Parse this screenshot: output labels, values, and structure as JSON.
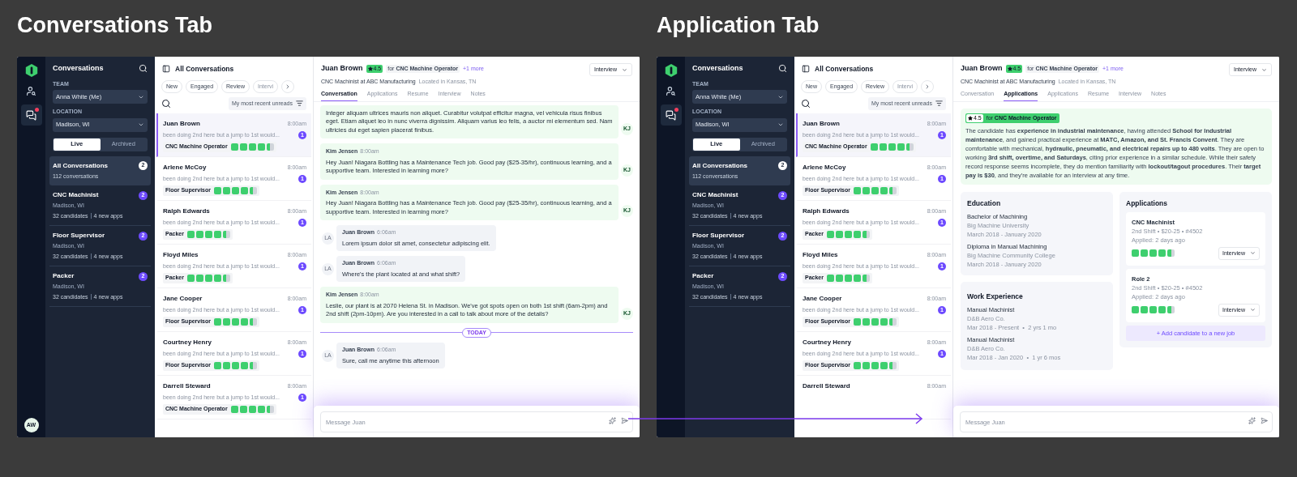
{
  "screens": [
    {
      "title": "Conversations Tab",
      "rail": {
        "avatar": "AW"
      },
      "sidebar": {
        "title": "Conversations",
        "team_label": "TEAM",
        "team": "Anna White (Me)",
        "location_label": "LOCATION",
        "location": "Madison, WI",
        "toggle": [
          {
            "label": "Live",
            "selected": true
          },
          {
            "label": "Archived",
            "selected": false
          }
        ],
        "groups": [
          {
            "name": "All Conversations",
            "sub": "112 conversations",
            "badge": "2",
            "selected": true
          },
          {
            "name": "CNC Machinist",
            "location": "Madison, WI",
            "candidates": "32 candidates",
            "apps": "4 new apps",
            "badge": "2",
            "selected": false
          },
          {
            "name": "Floor Supervisor",
            "location": "Madison, WI",
            "candidates": "32 candidates",
            "apps": "4 new apps",
            "badge": "2",
            "selected": false
          },
          {
            "name": "Packer",
            "location": "Madison, WI",
            "candidates": "32 candidates",
            "apps": "4 new apps",
            "badge": "2",
            "selected": false
          }
        ]
      },
      "list": {
        "title": "All Conversations",
        "filters": [
          "New",
          "Engaged",
          "Review",
          "Intervi"
        ],
        "sort": "My most recent unreads",
        "items": [
          {
            "name": "Juan Brown",
            "time": "8:00am",
            "preview": "been doing 2nd here but a jump to 1st would...",
            "unread": "1",
            "tag": "CNC Machine Operator",
            "stars": 4.5,
            "selected": true
          },
          {
            "name": "Arlene McCoy",
            "time": "8:00am",
            "preview": "been doing 2nd here but a jump to 1st would...",
            "unread": "1",
            "tag": "Floor Supervisor",
            "stars": 4.5,
            "selected": false
          },
          {
            "name": "Ralph Edwards",
            "time": "8:00am",
            "preview": "been doing 2nd here but a jump to 1st would...",
            "unread": "1",
            "tag": "Packer",
            "stars": 4.5,
            "selected": false
          },
          {
            "name": "Floyd Miles",
            "time": "8:00am",
            "preview": "been doing 2nd here but a jump to 1st would...",
            "unread": "1",
            "tag": "Packer",
            "stars": 4.5,
            "selected": false
          },
          {
            "name": "Jane Cooper",
            "time": "8:00am",
            "preview": "been doing 2nd here but a jump to 1st would...",
            "unread": "1",
            "tag": "Floor Supervisor",
            "stars": 4.5,
            "selected": false
          },
          {
            "name": "Courtney Henry",
            "time": "8:00am",
            "preview": "been doing 2nd here but a jump to 1st would...",
            "unread": "1",
            "tag": "Floor Supervisor",
            "stars": 4.5,
            "selected": false
          },
          {
            "name": "Darrell Steward",
            "time": "8:00am",
            "preview": "been doing 2nd here but a jump to 1st would...",
            "unread": "1",
            "tag": "CNC Machine Operator",
            "stars": 4.5,
            "selected": false
          }
        ]
      },
      "detail": {
        "kind": "conversation",
        "name": "Juan Brown",
        "rating": "4.5",
        "for": "for **CNC Machine Operator**",
        "more": "+1 more",
        "role": "CNC Machinist at ABC Manufacturing",
        "located": "Located in Kansas, TN",
        "status": "Interview",
        "tabs": [
          {
            "label": "Conversation",
            "selected": true
          },
          {
            "label": "Applications",
            "selected": false
          },
          {
            "label": "Resume",
            "selected": false
          },
          {
            "label": "Interview",
            "selected": false
          },
          {
            "label": "Notes",
            "selected": false
          }
        ],
        "messages": [
          {
            "kind": "recruiter",
            "text": "Integer aliquam ultrices mauris non aliquet. Curabitur volutpat efficitur magna, vel vehicula risus finibus eget. Etiam aliquet leo in nunc viverra dignissim. Aliquam varius leo felis, a auctor mi elementum sed. Nam ultricies dui eget sapien placerat finibus.",
            "avatar": "KJ"
          },
          {
            "kind": "recruiter",
            "author": "Kim Jensen",
            "time": "8:00am",
            "text": "Hey Juan! Niagara Bottling has a Maintenance Tech job. Good pay ($25-35/hr), continuous learning, and a supportive team. Interested in learning more?",
            "avatar": "KJ"
          },
          {
            "kind": "recruiter",
            "author": "Kim Jensen",
            "time": "8:00am",
            "text": "Hey Juan! Niagara Bottling has a Maintenance Tech job. Good pay ($25-35/hr), continuous learning, and a supportive team. Interested in learning more?",
            "avatar": "KJ"
          },
          {
            "kind": "candidate",
            "author": "Juan Brown",
            "time": "6:06am",
            "text": "Lorem ipsum dolor sit amet, consectetur adipiscing elit.",
            "avatar": "LA"
          },
          {
            "kind": "candidate",
            "author": "Juan Brown",
            "time": "6:06am",
            "text": "Where's the plant located at and what shift?",
            "avatar": "LA"
          },
          {
            "kind": "recruiter",
            "author": "Kim Jensen",
            "time": "8:00am",
            "text": "Leslie, our plant is at 2070 Helena St. in Madison. We've got spots open on both 1st shift (6am-2pm) and 2nd shift (2pm-10pm). Are you interested in a call to talk about more of the details?",
            "avatar": "KJ"
          },
          {
            "kind": "divider",
            "text": "TODAY"
          },
          {
            "kind": "candidate",
            "author": "Juan Brown",
            "time": "6:06am",
            "text": "Sure, call me anytime this afternoon",
            "avatar": "LA"
          }
        ],
        "composer": {
          "placeholder": "Message Juan"
        }
      }
    },
    {
      "title": "Application Tab",
      "sidebar": {
        "title": "Conversations",
        "team_label": "TEAM",
        "team": "Anna White (Me)",
        "location_label": "LOCATION",
        "location": "Madison, WI",
        "toggle": [
          {
            "label": "Live",
            "selected": true
          },
          {
            "label": "Archived",
            "selected": false
          }
        ],
        "groups": [
          {
            "name": "All Conversations",
            "sub": "112 conversations",
            "badge": "2",
            "selected": true
          },
          {
            "name": "CNC Machinist",
            "location": "Madison, WI",
            "candidates": "32 candidates",
            "apps": "4 new apps",
            "badge": "2",
            "selected": false
          },
          {
            "name": "Floor Supervisor",
            "location": "Madison, WI",
            "candidates": "32 candidates",
            "apps": "4 new apps",
            "badge": "2",
            "selected": false
          },
          {
            "name": "Packer",
            "location": "Madison, WI",
            "candidates": "32 candidates",
            "apps": "4 new apps",
            "badge": "2",
            "selected": false
          }
        ]
      },
      "list": {
        "title": "All Conversations",
        "filters": [
          "New",
          "Engaged",
          "Review",
          "Intervi"
        ],
        "sort": "My most recent unreads",
        "items": [
          {
            "name": "Juan Brown",
            "time": "8:00am",
            "preview": "been doing 2nd here but a jump to 1st would...",
            "unread": "1",
            "tag": "CNC Machine Operator",
            "stars": 4.5,
            "selected": true
          },
          {
            "name": "Arlene McCoy",
            "time": "8:00am",
            "preview": "been doing 2nd here but a jump to 1st would...",
            "unread": "1",
            "tag": "Floor Supervisor",
            "stars": 4.5,
            "selected": false
          },
          {
            "name": "Ralph Edwards",
            "time": "8:00am",
            "preview": "been doing 2nd here but a jump to 1st would...",
            "unread": "1",
            "tag": "Packer",
            "stars": 4.5,
            "selected": false
          },
          {
            "name": "Floyd Miles",
            "time": "8:00am",
            "preview": "been doing 2nd here but a jump to 1st would...",
            "unread": "1",
            "tag": "Packer",
            "stars": 4.5,
            "selected": false
          },
          {
            "name": "Jane Cooper",
            "time": "8:00am",
            "preview": "been doing 2nd here but a jump to 1st would...",
            "unread": "1",
            "tag": "Floor Supervisor",
            "stars": 4.5,
            "selected": false
          },
          {
            "name": "Courtney Henry",
            "time": "8:00am",
            "preview": "been doing 2nd here but a jump to 1st would...",
            "unread": "1",
            "tag": "Floor Supervisor",
            "stars": 4.5,
            "selected": false
          },
          {
            "name": "Darrell Steward",
            "time": "8:00am",
            "selected": false
          }
        ]
      },
      "detail": {
        "kind": "applications",
        "name": "Juan Brown",
        "rating": "4.5",
        "for": "for **CNC Machine Operator**",
        "more": "+1 more",
        "role": "CNC Machinist at ABC Manufacturing",
        "located": "Located in Kansas, TN",
        "status": "Interview",
        "tabs": [
          {
            "label": "Conversation",
            "selected": false
          },
          {
            "label": "Applications",
            "selected": true
          },
          {
            "label": "Applications",
            "selected": false
          },
          {
            "label": "Resume",
            "selected": false
          },
          {
            "label": "Interview",
            "selected": false
          },
          {
            "label": "Notes",
            "selected": false
          }
        ],
        "summary": {
          "rating": "4.5",
          "for": "for **CNC Machine Operator**",
          "text": "The candidate has **experience in industrial maintenance**, having attended **School for Industrial maintenance**, and gained practical experience at **MATC, Amazon, and St. Francis Convent**. They are comfortable with mechanical, **hydraulic, pneumatic, and electrical repairs up to 480 volts**. They are open to working **3rd shift, overtime, and Saturdays**, citing prior experience in a similar schedule. While their safety record response seems incomplete, they do mention familiarity with **lockout/tagout procedures**. Their **target pay is $30**, and they're available for an interview at any time."
        },
        "education": {
          "title": "Education",
          "entries": [
            {
              "title": "Bachelor of Machining",
              "org": "Big Machine University",
              "dates": "March 2018 - January 2020"
            },
            {
              "title": "Diploma in Manual Machining",
              "org": "Big Machine Community College",
              "dates": "March 2018 - January 2020"
            }
          ]
        },
        "work": {
          "title": "Work Experience",
          "entries": [
            {
              "title": "Manual Machinist",
              "org": "D&B Aero Co.",
              "dates": "Mar 2018 - Present  •  2 yrs 1 mo"
            },
            {
              "title": "Manual Machinist",
              "org": "D&B Aero Co.",
              "dates": "Mar 2018 - Jan 2020  •  1 yr 6 mos"
            }
          ]
        },
        "applications": {
          "title": "Applications",
          "entries": [
            {
              "title": "CNC Machinist",
              "meta": "2nd Shift • $20-25 • #4502",
              "applied": "Applied: 2 days ago",
              "stars": 4.5,
              "status": "Interview"
            },
            {
              "title": "Role 2",
              "meta": "2nd Shift • $20-25 • #4502",
              "applied": "Applied: 2 days ago",
              "stars": 4.5,
              "status": "Interview"
            }
          ],
          "add": "+ Add candidate to a new job"
        },
        "composer": {
          "placeholder": "Message Juan"
        }
      }
    }
  ]
}
